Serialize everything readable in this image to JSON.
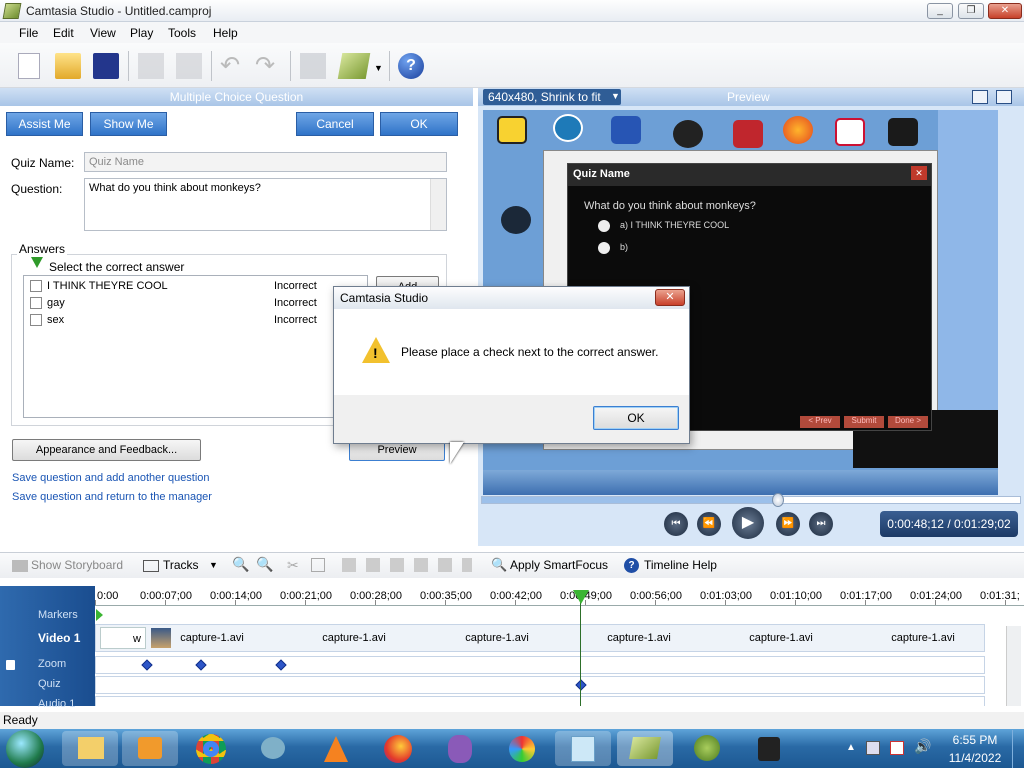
{
  "window": {
    "title": "Camtasia Studio - Untitled.camproj",
    "min": "_",
    "max": "❐",
    "close": "✕"
  },
  "menu": [
    "File",
    "Edit",
    "View",
    "Play",
    "Tools",
    "Help"
  ],
  "quiz_panel": {
    "header": "Multiple Choice Question",
    "assist_me": "Assist Me",
    "show_me": "Show Me",
    "cancel": "Cancel",
    "ok": "OK",
    "quiz_name_label": "Quiz Name:",
    "quiz_name_placeholder": "Quiz Name",
    "question_label": "Question:",
    "question_value": "What do you think about monkeys?",
    "answers_label": "Answers",
    "select_correct": "Select the correct answer",
    "answers": [
      {
        "text": "I THINK THEYRE COOL",
        "status": "Incorrect"
      },
      {
        "text": "gay",
        "status": "Incorrect"
      },
      {
        "text": "sex",
        "status": "Incorrect"
      }
    ],
    "add_button": "Add",
    "appearance_button": "Appearance and Feedback...",
    "preview_button": "Preview",
    "link_add_another": "Save question and add another question",
    "link_return": "Save question and return to the manager"
  },
  "preview": {
    "size_select": "640x480, Shrink to fit",
    "header": "Preview",
    "quiz_title": "Quiz Name",
    "quiz_question": "What do you think about monkeys?",
    "quiz_option_a": "a) I THINK THEYRE COOL",
    "quiz_option_b": "b)",
    "btn_prev": "< Prev",
    "btn_submit": "Submit",
    "btn_done": "Done >",
    "time": "0:00:48;12 / 0:01:29;02",
    "progress": 0.55
  },
  "dialog": {
    "title": "Camtasia Studio",
    "message": "Please place a check next to the correct answer.",
    "ok": "OK"
  },
  "timeline": {
    "show_storyboard": "Show Storyboard",
    "tracks": "Tracks",
    "apply_smartfocus": "Apply SmartFocus",
    "timeline_help": "Timeline Help",
    "ticks": [
      "0:00",
      "0:00:07;00",
      "0:00:14;00",
      "0:00:21;00",
      "0:00:28;00",
      "0:00:35;00",
      "0:00:42;00",
      "0:00:49;00",
      "0:00:56;00",
      "0:01:03;00",
      "0:01:10;00",
      "0:01:17;00",
      "0:01:24;00",
      "0:01:31;"
    ],
    "tracks_list": [
      "Markers",
      "Video 1",
      "Zoom",
      "Quiz",
      "Audio 1"
    ],
    "clip_label": "capture-1.avi",
    "clip_w": "w"
  },
  "status": "Ready",
  "clock": {
    "time": "6:55 PM",
    "date": "11/4/2022"
  },
  "colors": {
    "accent": "#2f73c8",
    "titlebar": "#a9c5e7",
    "timeline_track": "#1a4d8f"
  }
}
